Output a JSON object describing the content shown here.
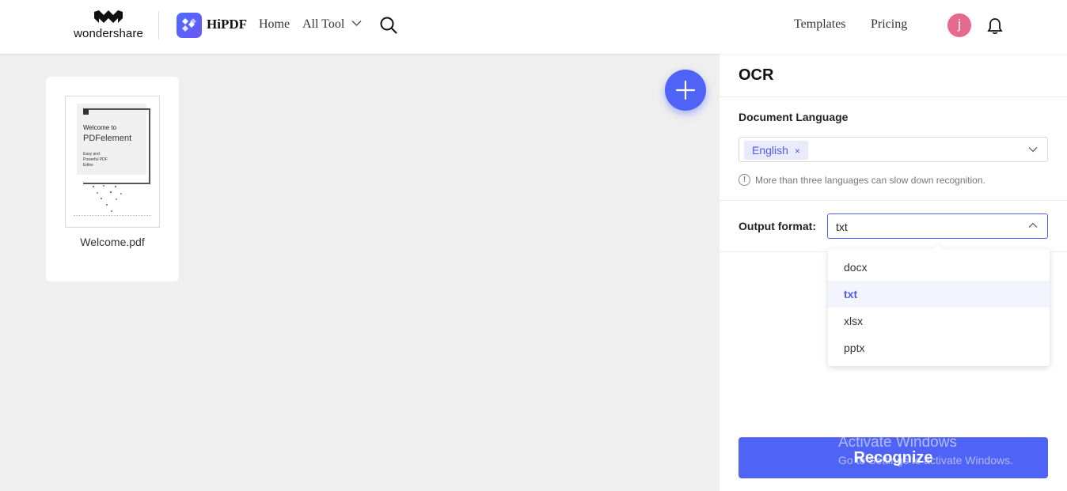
{
  "header": {
    "brand_text": "wondershare",
    "app_name": "HiPDF",
    "nav": {
      "home": "Home",
      "all_tool": "All Tool",
      "templates": "Templates",
      "pricing": "Pricing"
    },
    "avatar_initial": "j",
    "icons": [
      "wondershare-logo-icon",
      "hipdf-logo-icon",
      "chevron-down-icon",
      "search-icon",
      "bell-icon"
    ]
  },
  "workspace": {
    "file": {
      "name": "Welcome.pdf",
      "thumb_title_line1": "Welcome to",
      "thumb_title_line2": "PDFelement",
      "thumb_sub": "Easy and Powerful PDF Editor"
    },
    "add_button_icon": "plus-icon"
  },
  "panel": {
    "title": "OCR",
    "language_label": "Document Language",
    "language_tag": "English",
    "language_tag_close": "×",
    "hint": "More than three languages can slow down recognition.",
    "hint_icon": "!",
    "output_label": "Output format:",
    "output_value": "txt",
    "output_options": [
      "docx",
      "txt",
      "xlsx",
      "pptx"
    ],
    "output_selected": "txt",
    "recognize_label": "Recognize"
  },
  "overlay": {
    "watermark_line1": "Activate Windows",
    "watermark_line2": "Go to Settings to activate Windows."
  },
  "colors": {
    "accent": "#4f63f6",
    "tag_bg": "#e9ebfd",
    "avatar": "#e8698f",
    "workspace_bg": "#efefef"
  }
}
